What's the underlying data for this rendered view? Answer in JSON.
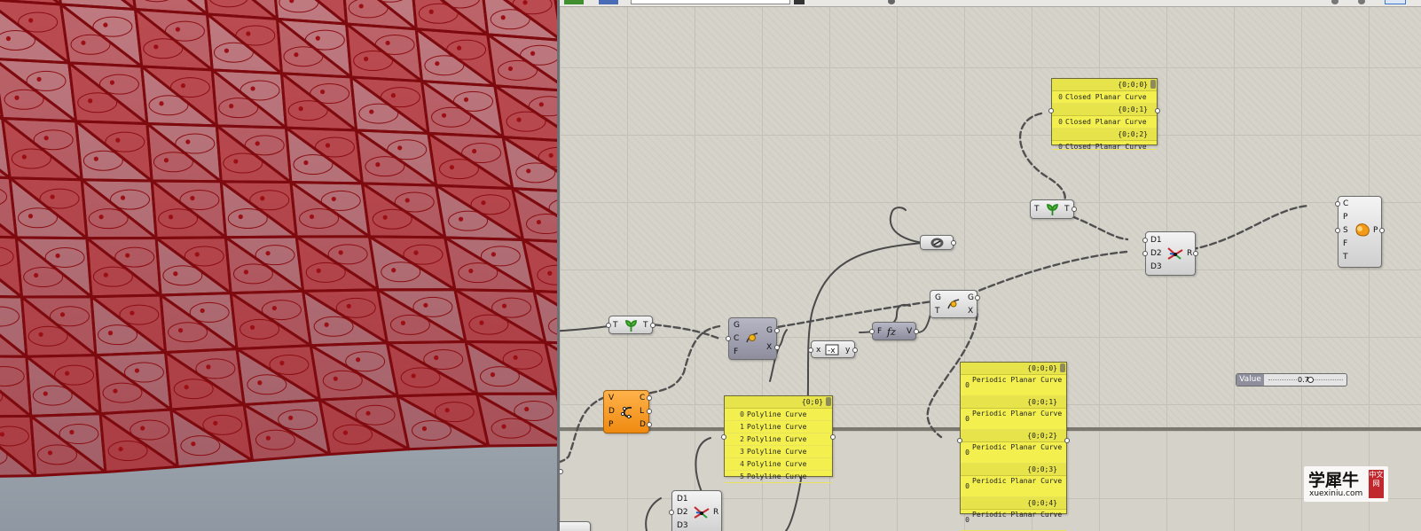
{
  "canvas": {
    "panels": {
      "closed_curves": {
        "entries": [
          {
            "path": "{0;0;0}",
            "index": "0",
            "text": "Closed Planar Curve"
          },
          {
            "path": "{0;0;1}",
            "index": "0",
            "text": "Closed Planar Curve"
          },
          {
            "path": "{0;0;2}",
            "index": "0",
            "text": "Closed Planar Curve"
          }
        ]
      },
      "polylines": {
        "path": "{0;0}",
        "rows": [
          {
            "index": "0",
            "text": "Polyline Curve"
          },
          {
            "index": "1",
            "text": "Polyline Curve"
          },
          {
            "index": "2",
            "text": "Polyline Curve"
          },
          {
            "index": "3",
            "text": "Polyline Curve"
          },
          {
            "index": "4",
            "text": "Polyline Curve"
          },
          {
            "index": "5",
            "text": "Polyline Curve"
          }
        ]
      },
      "periodic_curves": {
        "entries": [
          {
            "path": "{0;0;0}",
            "index": "0",
            "text": "Periodic Planar Curve"
          },
          {
            "path": "{0;0;1}",
            "index": "0",
            "text": "Periodic Planar Curve"
          },
          {
            "path": "{0;0;2}",
            "index": "0",
            "text": "Periodic Planar Curve"
          },
          {
            "path": "{0;0;3}",
            "index": "0",
            "text": "Periodic Planar Curve"
          },
          {
            "path": "{0;0;4}",
            "index": "0",
            "text": "Periodic Planar Curve"
          }
        ]
      }
    },
    "slider": {
      "label": "Value",
      "value": "0.7",
      "fraction": 0.55
    },
    "components": {
      "graft_left": {
        "in": "T",
        "out": "T",
        "icon": "graft-tree-icon"
      },
      "graft_right": {
        "in": "T",
        "out": "T",
        "icon": "graft-tree-icon"
      },
      "closed_curve_mid": {
        "inputs": [
          "G",
          "C",
          "F"
        ],
        "outputs": [
          "G",
          "X"
        ],
        "icon": "curve-closed-icon"
      },
      "closed_curve_right": {
        "inputs": [
          "G",
          "T"
        ],
        "outputs": [
          "G",
          "X"
        ],
        "icon": "curve-closed-icon"
      },
      "negative": {
        "in": "x",
        "out": "y",
        "icon": "negative-icon"
      },
      "evaluate_f": {
        "in": "F",
        "out": "V",
        "icon": "expression-icon"
      },
      "relay_icon": "relay-icon",
      "divide": {
        "inputs": [
          "V",
          "D",
          "P"
        ],
        "outputs": [
          "C",
          "L",
          "D"
        ],
        "icon": "divide-curve-icon"
      },
      "dispatch_right": {
        "inputs": [
          "D1",
          "D2",
          "D3"
        ],
        "output": "R",
        "icon": "merge-icon"
      },
      "dispatch_bottom": {
        "inputs": [
          "D1",
          "D2",
          "D3"
        ],
        "output": "R",
        "icon": "merge-icon"
      },
      "patch": {
        "inputs": [
          "C",
          "P",
          "S",
          "F",
          "T"
        ],
        "output": "P",
        "icon": "patch-surface-icon"
      }
    }
  },
  "watermark": {
    "cn": "学犀牛",
    "en": "xuexiniu.com",
    "badge": "中文网"
  },
  "colors": {
    "viewport_red": "#b3141a",
    "panel_yellow": "#f2ef4f",
    "component_orange": "#ef8a10"
  }
}
